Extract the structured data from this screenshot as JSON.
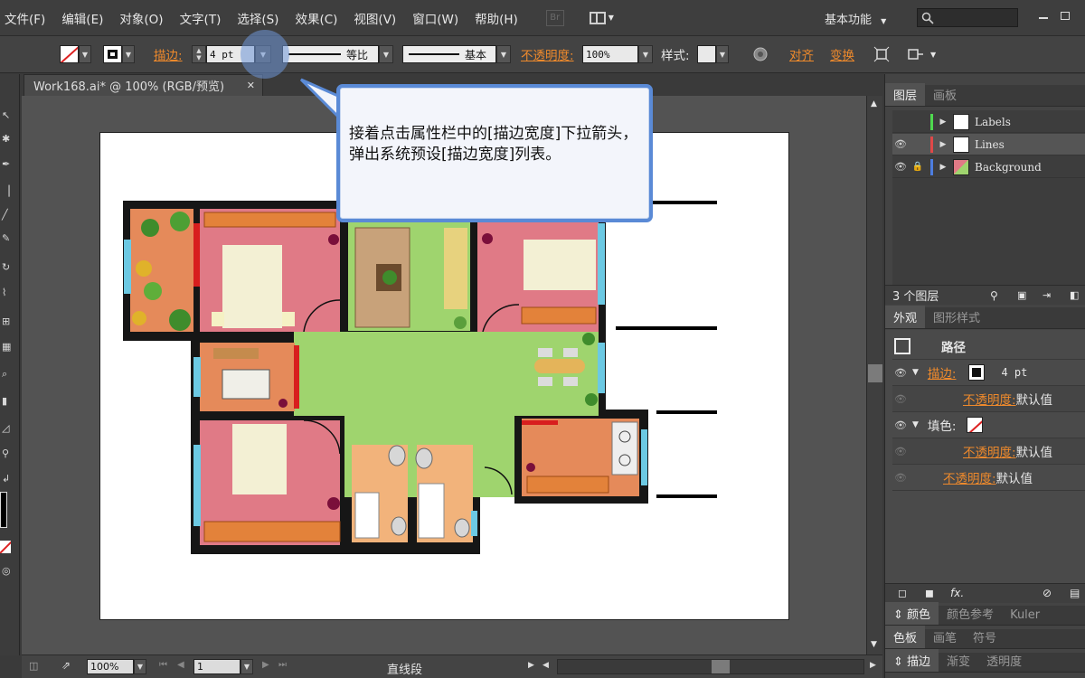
{
  "menu": [
    "文件(F)",
    "编辑(E)",
    "对象(O)",
    "文字(T)",
    "选择(S)",
    "效果(C)",
    "视图(V)",
    "窗口(W)",
    "帮助(H)"
  ],
  "menu_bridge": "Br",
  "workspace_label": "基本功能",
  "control": {
    "stroke_label": "描边:",
    "stroke_weight": "4 pt",
    "profile_label": "等比",
    "brush_label": "基本",
    "opacity_label": "不透明度:",
    "opacity_value": "100%",
    "style_label": "样式:",
    "align_label": "对齐",
    "transform_label": "变换"
  },
  "document_tab": "Work168.ai* @ 100% (RGB/预览)",
  "callout": "接着点击属性栏中的[描边宽度]下拉箭头，弹出系统预设[描边宽度]列表。",
  "layers_panel": {
    "tabs": [
      "图层",
      "画板"
    ],
    "layers": [
      {
        "name": "Labels",
        "color": "#4fd94f",
        "visible": false,
        "locked": false
      },
      {
        "name": "Lines",
        "color": "#e04848",
        "visible": true,
        "locked": false
      },
      {
        "name": "Background",
        "color": "#4d7de0",
        "visible": true,
        "locked": true
      }
    ],
    "count": "3 个图层"
  },
  "appearance_panel": {
    "tabs": [
      "外观",
      "图形样式"
    ],
    "title": "路径",
    "stroke_label": "描边:",
    "stroke_value": "4 pt",
    "opacity_label": "不透明度:",
    "default_value": "默认值",
    "fill_label": "填色:",
    "fx": "fx."
  },
  "bottom_panels": {
    "row1": [
      "颜色",
      "颜色参考",
      "Kuler"
    ],
    "row2": [
      "色板",
      "画笔",
      "符号"
    ],
    "row3": [
      "描边",
      "渐变",
      "透明度"
    ]
  },
  "status": {
    "zoom": "100%",
    "artboard": "1",
    "tool": "直线段"
  }
}
